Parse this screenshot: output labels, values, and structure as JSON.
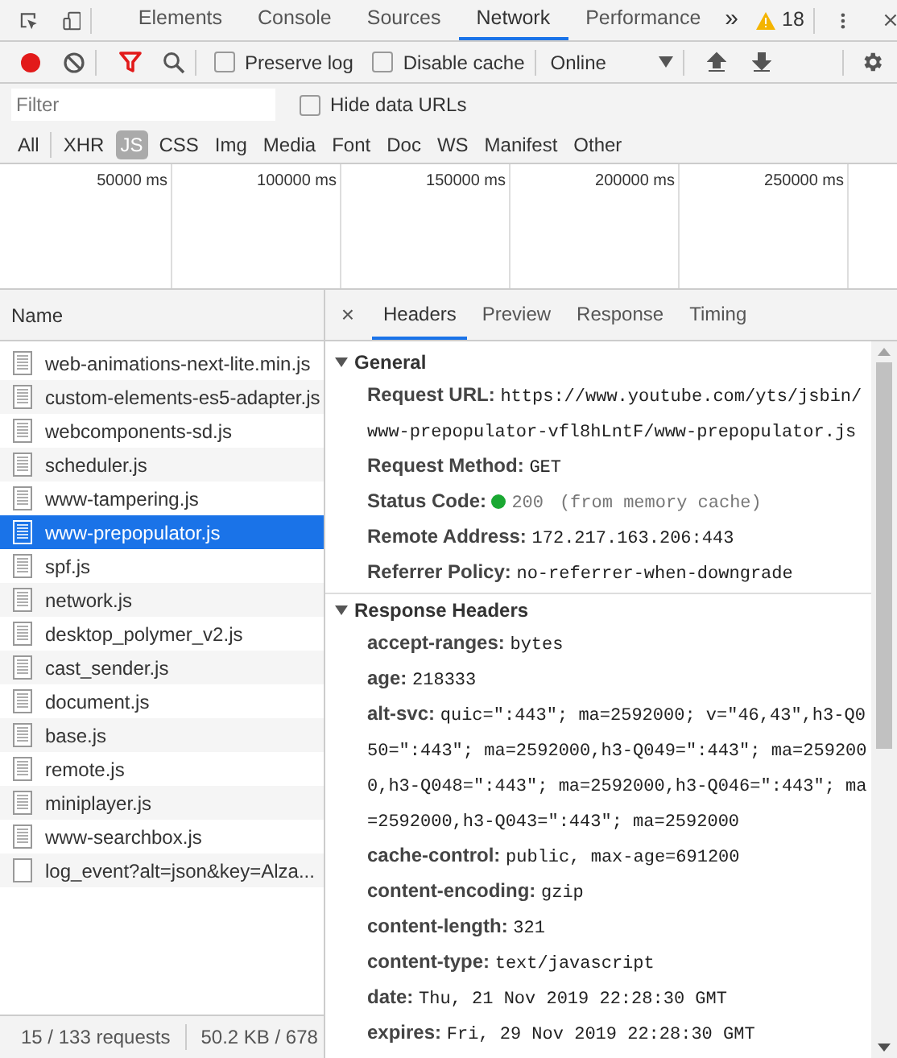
{
  "panel_tabs": [
    {
      "label": "Elements",
      "selected": false
    },
    {
      "label": "Console",
      "selected": false
    },
    {
      "label": "Sources",
      "selected": false
    },
    {
      "label": "Network",
      "selected": true
    },
    {
      "label": "Performance",
      "selected": false
    }
  ],
  "more_tabs": "»",
  "warning_count": "18",
  "toolbar": {
    "recording": true,
    "filter_active": true,
    "checkboxes": [
      {
        "label": "Preserve log",
        "checked": false
      },
      {
        "label": "Disable cache",
        "checked": false
      }
    ],
    "throttling": "Online"
  },
  "filter": {
    "placeholder": "Filter",
    "hide_data_urls": {
      "label": "Hide data URLs",
      "checked": false
    }
  },
  "types": [
    {
      "label": "All",
      "selected": false
    },
    {
      "label": "XHR",
      "selected": false
    },
    {
      "label": "JS",
      "selected": true
    },
    {
      "label": "CSS",
      "selected": false
    },
    {
      "label": "Img",
      "selected": false
    },
    {
      "label": "Media",
      "selected": false
    },
    {
      "label": "Font",
      "selected": false
    },
    {
      "label": "Doc",
      "selected": false
    },
    {
      "label": "WS",
      "selected": false
    },
    {
      "label": "Manifest",
      "selected": false
    },
    {
      "label": "Other",
      "selected": false
    }
  ],
  "timeline": {
    "ticks": [
      "50000 ms",
      "100000 ms",
      "150000 ms",
      "200000 ms",
      "250000 ms"
    ]
  },
  "requests": {
    "column": "Name",
    "rows": [
      {
        "name": "web-animations-next-lite.min.js",
        "kind": "script",
        "selected": false
      },
      {
        "name": "custom-elements-es5-adapter.js",
        "kind": "script",
        "selected": false
      },
      {
        "name": "webcomponents-sd.js",
        "kind": "script",
        "selected": false
      },
      {
        "name": "scheduler.js",
        "kind": "script",
        "selected": false
      },
      {
        "name": "www-tampering.js",
        "kind": "script",
        "selected": false
      },
      {
        "name": "www-prepopulator.js",
        "kind": "script",
        "selected": true
      },
      {
        "name": "spf.js",
        "kind": "script",
        "selected": false
      },
      {
        "name": "network.js",
        "kind": "script",
        "selected": false
      },
      {
        "name": "desktop_polymer_v2.js",
        "kind": "script",
        "selected": false
      },
      {
        "name": "cast_sender.js",
        "kind": "script",
        "selected": false
      },
      {
        "name": "document.js",
        "kind": "script",
        "selected": false
      },
      {
        "name": "base.js",
        "kind": "script",
        "selected": false
      },
      {
        "name": "remote.js",
        "kind": "script",
        "selected": false
      },
      {
        "name": "miniplayer.js",
        "kind": "script",
        "selected": false
      },
      {
        "name": "www-searchbox.js",
        "kind": "script",
        "selected": false
      },
      {
        "name": "log_event?alt=json&key=Alza...",
        "kind": "other",
        "selected": false
      }
    ]
  },
  "status_bar": [
    "15 / 133 requests",
    "50.2 KB / 678"
  ],
  "details": {
    "close": "×",
    "tabs": [
      {
        "label": "Headers",
        "selected": true
      },
      {
        "label": "Preview",
        "selected": false
      },
      {
        "label": "Response",
        "selected": false
      },
      {
        "label": "Timing",
        "selected": false
      }
    ],
    "sections": [
      {
        "title": "General",
        "expanded": true,
        "headers": [
          {
            "kind": "plain",
            "name": "Request URL:",
            "value": "https://www.youtube.com/yts/jsbin/www-prepopulator-vfl8hLntF/www-prepopulator.js"
          },
          {
            "kind": "plain",
            "name": "Request Method:",
            "value": "GET"
          },
          {
            "kind": "status",
            "name": "Status Code:",
            "value": "200",
            "note": "(from memory cache)",
            "color": "#1aa832"
          },
          {
            "kind": "plain",
            "name": "Remote Address:",
            "value": "172.217.163.206:443"
          },
          {
            "kind": "plain",
            "name": "Referrer Policy:",
            "value": "no-referrer-when-downgrade"
          }
        ]
      },
      {
        "title": "Response Headers",
        "expanded": true,
        "headers": [
          {
            "kind": "plain",
            "name": "accept-ranges:",
            "value": "bytes"
          },
          {
            "kind": "plain",
            "name": "age:",
            "value": "218333"
          },
          {
            "kind": "plain",
            "name": "alt-svc:",
            "value": "quic=\":443\"; ma=2592000; v=\"46,43\",h3-Q050=\":443\"; ma=2592000,h3-Q049=\":443\"; ma=2592000,h3-Q048=\":443\"; ma=2592000,h3-Q046=\":443\"; ma=2592000,h3-Q043=\":443\"; ma=2592000"
          },
          {
            "kind": "plain",
            "name": "cache-control:",
            "value": "public, max-age=691200"
          },
          {
            "kind": "plain",
            "name": "content-encoding:",
            "value": "gzip"
          },
          {
            "kind": "plain",
            "name": "content-length:",
            "value": "321"
          },
          {
            "kind": "plain",
            "name": "content-type:",
            "value": "text/javascript"
          },
          {
            "kind": "plain",
            "name": "date:",
            "value": "Thu, 21 Nov 2019 22:28:30 GMT"
          },
          {
            "kind": "plain",
            "name": "expires:",
            "value": "Fri, 29 Nov 2019 22:28:30 GMT"
          }
        ]
      }
    ]
  }
}
